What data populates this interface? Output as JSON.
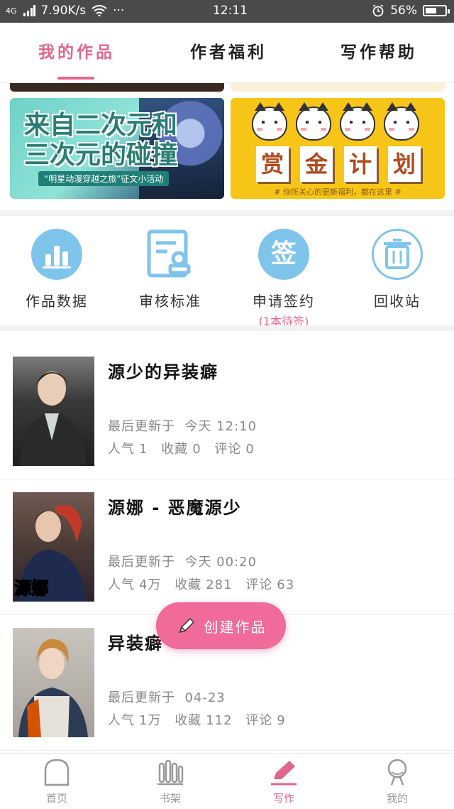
{
  "status_bar": {
    "network": "4G",
    "speed": "7.90K/s",
    "more": "···",
    "time": "12:11",
    "battery": "56%",
    "battery_level": 0.56
  },
  "tabs": [
    {
      "label": "我的作品",
      "active": true
    },
    {
      "label": "作者福利",
      "active": false
    },
    {
      "label": "写作帮助",
      "active": false
    }
  ],
  "banners": {
    "left": {
      "title": "来自二次元和三次元的碰撞",
      "subtitle": "“明星动漫穿越之旅”征文小活动"
    },
    "right": {
      "chars": [
        "赏",
        "金",
        "计",
        "划"
      ],
      "subtitle": "# 你所关心的更新福利，都在这里 #"
    }
  },
  "shortcuts": [
    {
      "label": "作品数据",
      "icon": "bar-chart-icon"
    },
    {
      "label": "审核标准",
      "icon": "document-stamp-icon"
    },
    {
      "label": "申请签约",
      "sub": "(1本待签)",
      "icon": "sign-icon",
      "icon_char": "签"
    },
    {
      "label": "回收站",
      "icon": "trash-icon"
    }
  ],
  "works": [
    {
      "title": "源少的异装癖",
      "updated_prefix": "最后更新于",
      "updated": "今天 12:10",
      "popularity_label": "人气",
      "popularity": "1",
      "favorites_label": "收藏",
      "favorites": "0",
      "comments_label": "评论",
      "comments": "0"
    },
    {
      "title": "源娜 - 恶魔源少",
      "updated_prefix": "最后更新于",
      "updated": "今天 00:20",
      "popularity_label": "人气",
      "popularity": "4万",
      "favorites_label": "收藏",
      "favorites": "281",
      "comments_label": "评论",
      "comments": "63",
      "cover_text": "源娜"
    },
    {
      "title": "异装癖",
      "updated_prefix": "最后更新于",
      "updated": "04-23",
      "popularity_label": "人气",
      "popularity": "1万",
      "favorites_label": "收藏",
      "favorites": "112",
      "comments_label": "评论",
      "comments": "9"
    }
  ],
  "fab": {
    "label": "创建作品"
  },
  "bottom_nav": [
    {
      "label": "首页",
      "icon": "home-icon",
      "active": false
    },
    {
      "label": "书架",
      "icon": "bookshelf-icon",
      "active": false
    },
    {
      "label": "写作",
      "icon": "pen-icon",
      "active": true
    },
    {
      "label": "我的",
      "icon": "profile-icon",
      "active": false
    }
  ],
  "colors": {
    "accent": "#e0678c",
    "fab": "#f06a9a",
    "icon_blue": "#7fc4ea"
  }
}
